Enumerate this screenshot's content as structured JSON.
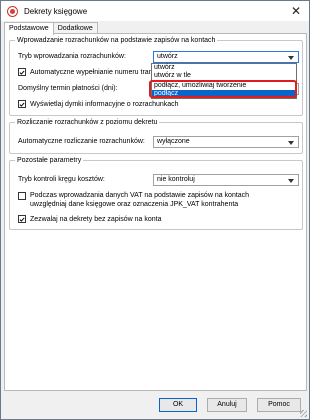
{
  "window": {
    "title": "Dekrety księgowe",
    "close_symbol": "✕"
  },
  "tabs": [
    {
      "label": "Podstawowe",
      "active": true
    },
    {
      "label": "Dodatkowe",
      "active": false
    }
  ],
  "group1": {
    "title": "Wprowadzanie rozrachunków na podstawie zapisów na kontach",
    "mode_label": "Tryb wprowadzania rozrachunków:",
    "mode_value": "utwórz",
    "auto_fill_label": "Automatyczne wypełnianie numeru transakcji",
    "auto_fill_checked": true,
    "due_date_label": "Domyślny termin płatności (dni):",
    "due_date_value": "",
    "tooltips_label": "Wyświetlaj dymki informacyjne o rozrachunkach",
    "tooltips_checked": true,
    "dropdown_options": [
      "utwórz",
      "utwórz w tle",
      "podłącz, umożliwiaj tworzenie",
      "podłącz"
    ],
    "dropdown_selected_index": 3
  },
  "group2": {
    "title": "Rozliczanie rozrachunków z poziomu dekretu",
    "auto_settle_label": "Automatyczne rozliczanie rozrachunków:",
    "auto_settle_value": "wyłączone"
  },
  "group3": {
    "title": "Pozostałe parametry",
    "control_label": "Tryb kontroli kręgu kosztów:",
    "control_value": "nie kontroluj",
    "vat_label_line1": "Podczas wprowadzania danych VAT na podstawie zapisów na kontach",
    "vat_label_line2": "uwzględniaj dane księgowe oraz oznaczenia JPK_VAT kontrahenta",
    "vat_checked": false,
    "allow_empty_label": "Zezwalaj na dekrety bez zapisów na konta",
    "allow_empty_checked": true
  },
  "buttons": {
    "ok": "OK",
    "cancel": "Anuluj",
    "help": "Pomoc"
  },
  "colors": {
    "selection": "#0a64c9",
    "highlight_border": "#e01c1c"
  },
  "icons": {
    "app": "dekrety-app-icon",
    "close": "close-icon",
    "check": "check-icon",
    "dropdown": "chevron-down-icon",
    "resize": "resize-grip-icon"
  }
}
